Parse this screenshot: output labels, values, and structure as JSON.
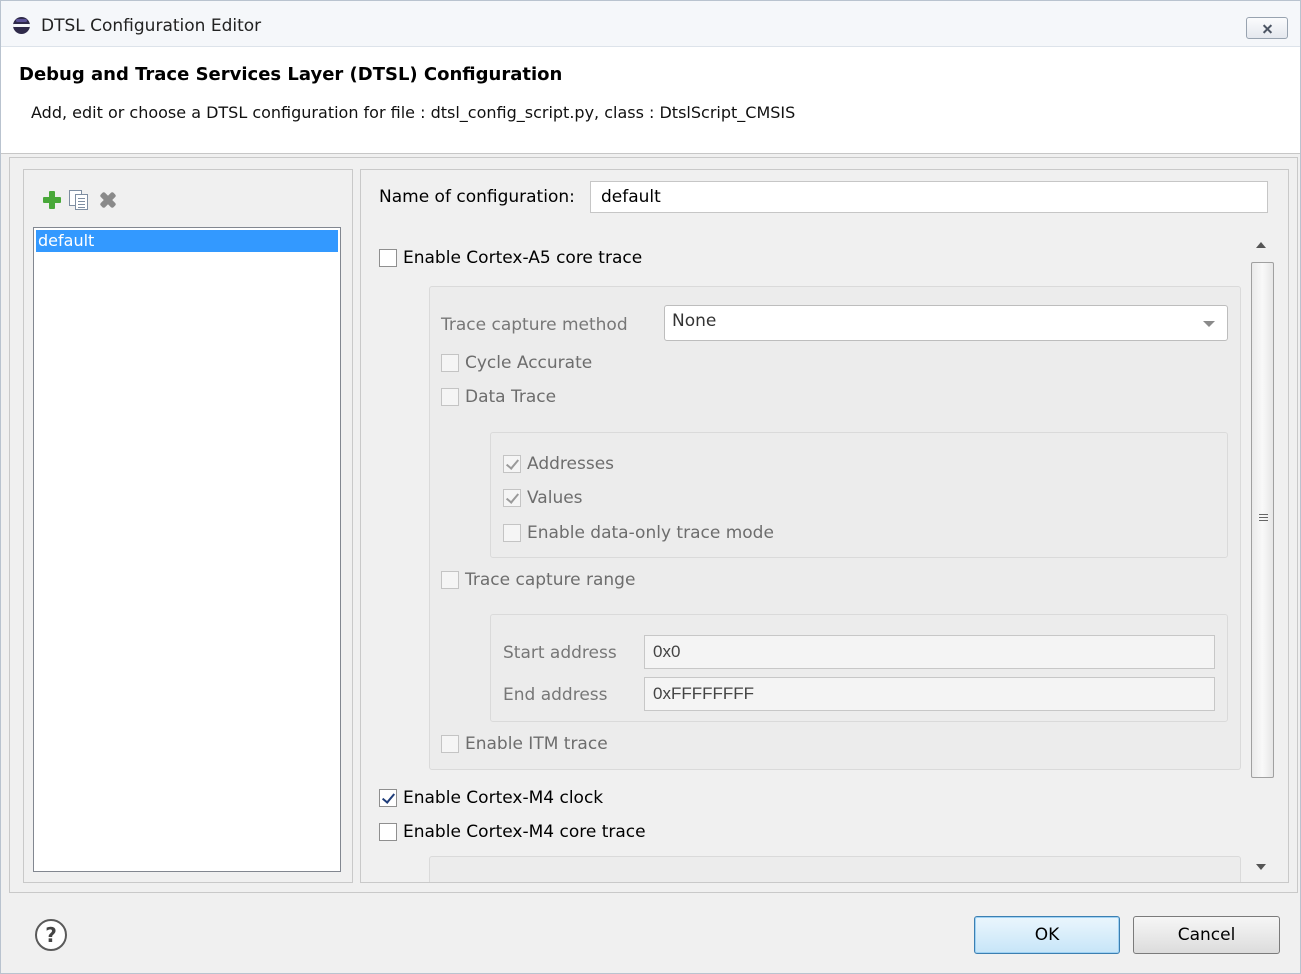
{
  "window": {
    "title": "DTSL Configuration Editor",
    "icon": "eclipse-app-icon",
    "close_icon": "close-icon"
  },
  "header": {
    "title": "Debug and Trace Services Layer (DTSL) Configuration",
    "description": "Add, edit or choose a DTSL configuration for file : dtsl_config_script.py, class : DtslScript_CMSIS"
  },
  "sidebar": {
    "toolbar": [
      "add-icon",
      "copy-icon",
      "delete-icon"
    ],
    "items": [
      {
        "label": "default",
        "selected": true
      }
    ]
  },
  "config": {
    "name_label": "Name of configuration:",
    "name_value": "default",
    "a5_trace": {
      "label": "Enable Cortex-A5 core trace",
      "checked": false
    },
    "capture_method_label": "Trace capture method",
    "capture_method_value": "None",
    "cycle_accurate": {
      "label": "Cycle Accurate",
      "checked": false
    },
    "data_trace": {
      "label": "Data Trace",
      "checked": false
    },
    "addresses": {
      "label": "Addresses",
      "checked": true
    },
    "values": {
      "label": "Values",
      "checked": true
    },
    "data_only": {
      "label": "Enable data-only trace mode",
      "checked": false
    },
    "capture_range": {
      "label": "Trace capture range",
      "checked": false
    },
    "start_address_label": "Start address",
    "start_address_value": "0x0",
    "end_address_label": "End address",
    "end_address_value": "0xFFFFFFFF",
    "itm_trace": {
      "label": "Enable ITM trace",
      "checked": false
    },
    "m4_clock": {
      "label": "Enable Cortex-M4 clock",
      "checked": true
    },
    "m4_trace": {
      "label": "Enable Cortex-M4 core trace",
      "checked": false
    }
  },
  "footer": {
    "help_icon": "help-icon",
    "help_glyph": "?",
    "ok_label": "OK",
    "cancel_label": "Cancel"
  }
}
